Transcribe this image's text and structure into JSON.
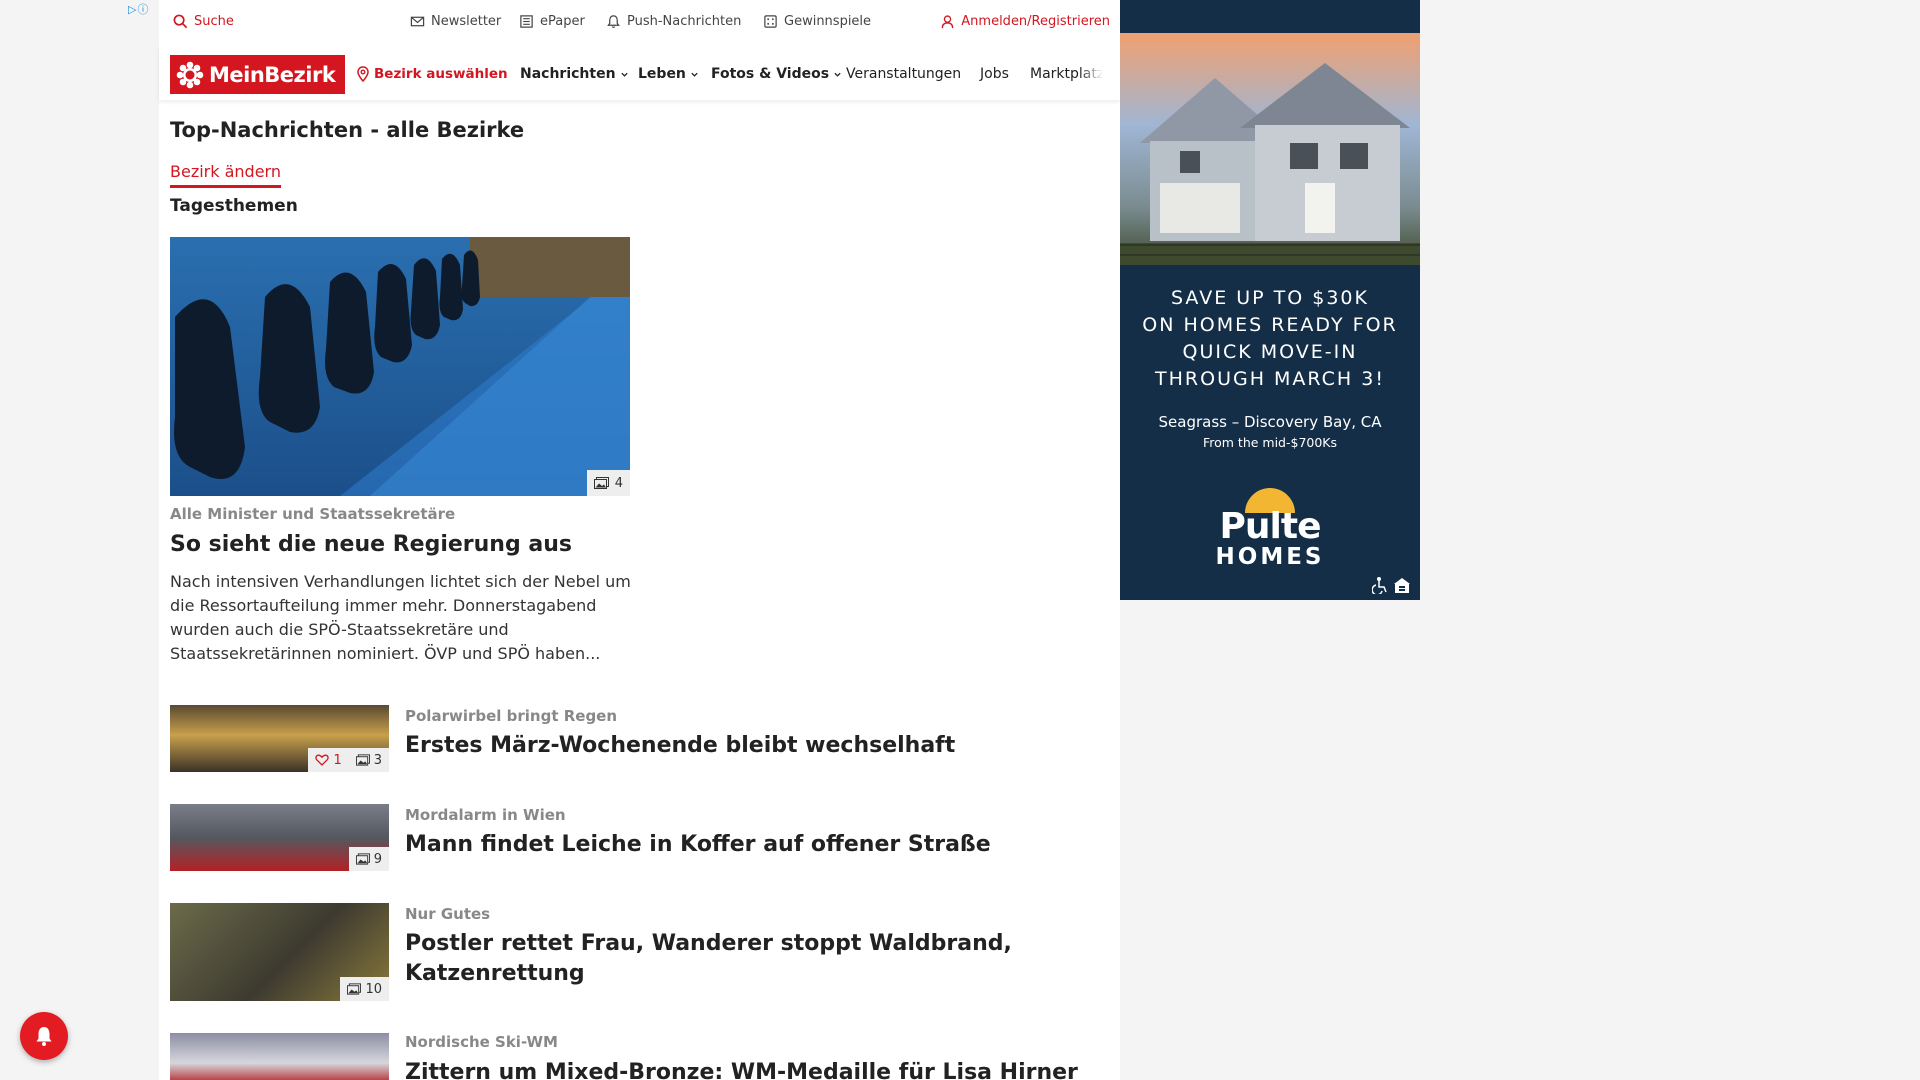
{
  "utility": {
    "search": "Suche",
    "newsletter": "Newsletter",
    "epaper": "ePaper",
    "push": "Push-Nachrichten",
    "gewinnspiele": "Gewinnspiele",
    "login": "Anmelden/Registrieren"
  },
  "nav": {
    "logo": "MeinBezirk",
    "bezirk_select": "Bezirk auswählen",
    "items": [
      {
        "label": "Nachrichten",
        "dropdown": true
      },
      {
        "label": "Leben",
        "dropdown": true
      },
      {
        "label": "Fotos & Videos",
        "dropdown": true
      },
      {
        "label": "Veranstaltungen",
        "dropdown": false
      },
      {
        "label": "Jobs",
        "dropdown": false
      },
      {
        "label": "Marktplatz",
        "dropdown": false
      }
    ]
  },
  "page": {
    "title": "Top-Nachrichten - alle Bezirke",
    "change_bezirk": "Bezirk ändern",
    "section": "Tagesthemen"
  },
  "lead": {
    "image_count": "4",
    "kicker": "Alle Minister und Staatssekretäre",
    "title": "So sieht die neue Regierung aus",
    "teaser": "Nach intensiven Verhandlungen lichtet sich der Nebel um die Ressortaufteilung immer mehr. Donnerstagabend wurden auch die SPÖ-Staatssekretäre und Staatssekretärinnen nominiert. ÖVP und SPÖ haben..."
  },
  "articles": [
    {
      "kicker": "Polarwirbel bringt Regen",
      "title": "Erstes März-Wochenende bleibt wechselhaft",
      "likes": "1",
      "images": "3"
    },
    {
      "kicker": "Mordalarm in Wien",
      "title": "Mann findet Leiche in Koffer auf offener Straße",
      "images": "9"
    },
    {
      "kicker": "Nur Gutes",
      "title": "Postler rettet Frau, Wanderer stoppt Waldbrand, Katzenrettung",
      "images": "10"
    },
    {
      "kicker": "Nordische Ski-WM",
      "title": "Zittern um Mixed-Bronze: WM-Medaille für Lisa Hirner"
    }
  ],
  "ad": {
    "headline": [
      "SAVE UP TO $30K",
      "ON HOMES READY FOR",
      "QUICK MOVE-IN",
      "THROUGH MARCH 3!"
    ],
    "location": "Seagrass – Discovery Bay, CA",
    "price": "From the mid-$700Ks",
    "brand": "Pulte",
    "brand_sub": "HOMES"
  },
  "colors": {
    "brand_red": "#d3161f",
    "ad_bg": "#142e48",
    "kicker_gray": "#888888"
  },
  "icons": {
    "search": "search-icon",
    "newsletter": "mail-icon",
    "epaper": "newspaper-icon",
    "push": "bell-icon",
    "gewinnspiele": "gift-icon",
    "login": "user-icon",
    "bezirk": "location-pin-icon",
    "gallery": "image-gallery-icon",
    "like": "heart-icon"
  }
}
